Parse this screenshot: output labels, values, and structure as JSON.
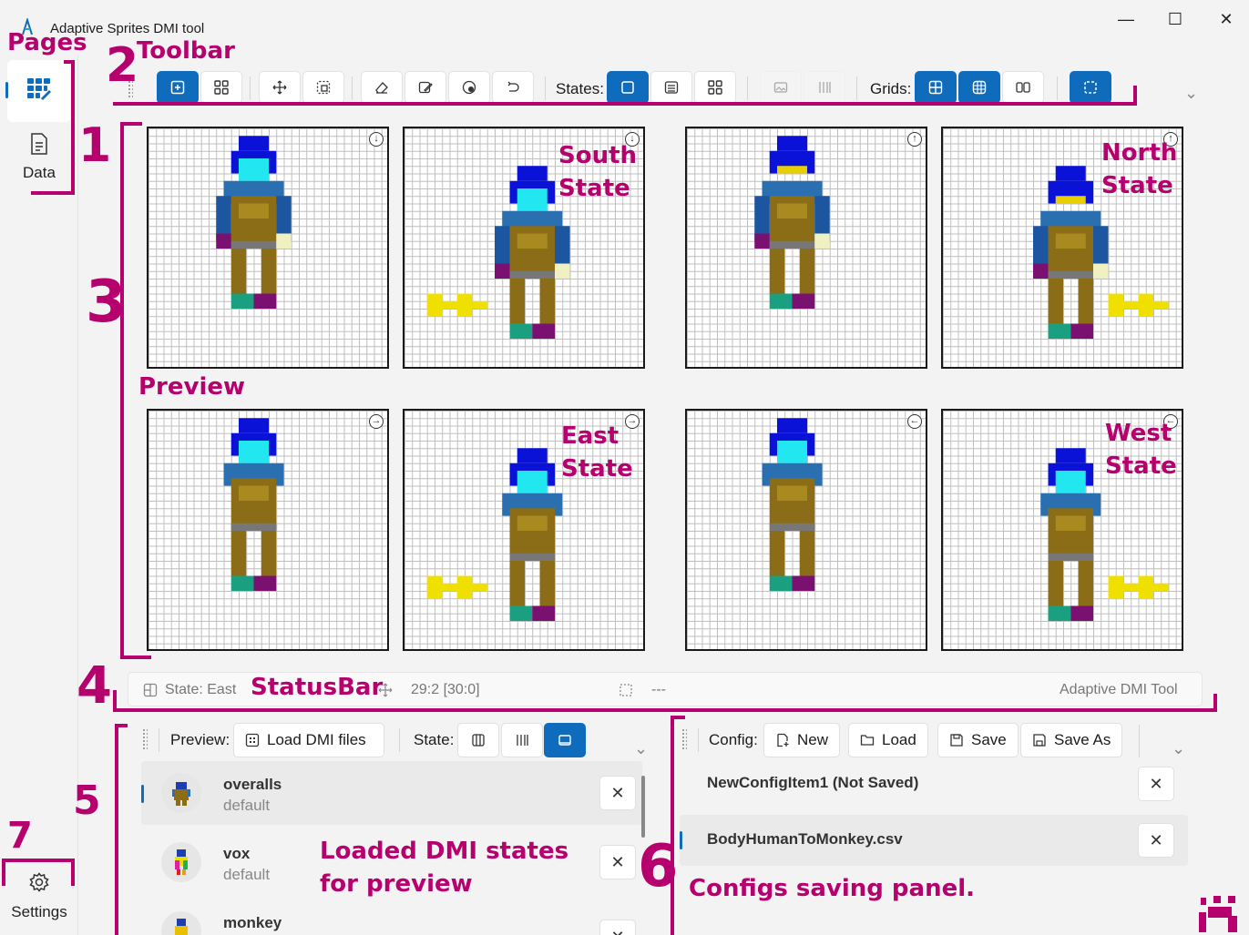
{
  "window": {
    "title": "Adaptive Sprites DMI tool",
    "minimize": "—",
    "maximize": "☐",
    "close": "✕"
  },
  "nav": {
    "items": [
      {
        "label": "",
        "icon": "grid-icon"
      },
      {
        "label": "Data",
        "icon": "document-icon"
      }
    ],
    "settings": {
      "label": "Settings",
      "icon": "gear-icon"
    }
  },
  "toolbar": {
    "states_label": "States:",
    "grids_label": "Grids:",
    "chevron": "⌄"
  },
  "preview": {
    "tiles": [
      {
        "direction": "south",
        "dir_glyph": "↓",
        "variant": "overalls"
      },
      {
        "direction": "south",
        "dir_glyph": "↓",
        "variant": "monkey"
      },
      {
        "direction": "north",
        "dir_glyph": "↑",
        "variant": "overalls"
      },
      {
        "direction": "north",
        "dir_glyph": "↑",
        "variant": "monkey"
      },
      {
        "direction": "east",
        "dir_glyph": "→",
        "variant": "overalls"
      },
      {
        "direction": "east",
        "dir_glyph": "→",
        "variant": "monkey"
      },
      {
        "direction": "west",
        "dir_glyph": "←",
        "variant": "overalls"
      },
      {
        "direction": "west",
        "dir_glyph": "←",
        "variant": "monkey"
      }
    ]
  },
  "statusbar": {
    "state": "State: East",
    "coords": "29:2 [30:0]",
    "selection": "---",
    "app_name": "Adaptive DMI Tool"
  },
  "preview_panel": {
    "preview_label": "Preview:",
    "load_button": "Load DMI files",
    "state_label": "State:",
    "items": [
      {
        "title": "overalls",
        "subtitle": "default",
        "selected": true
      },
      {
        "title": "vox",
        "subtitle": "default",
        "selected": false
      },
      {
        "title": "monkey",
        "subtitle": "",
        "selected": false
      }
    ]
  },
  "config_panel": {
    "config_label": "Config:",
    "new_button": "New",
    "load_button": "Load",
    "save_button": "Save",
    "save_as_button": "Save As",
    "items": [
      {
        "title": "NewConfigItem1 (Not Saved)",
        "selected": false
      },
      {
        "title": "BodyHumanToMonkey.csv",
        "selected": true
      }
    ]
  },
  "annotations": {
    "pages": "Pages",
    "toolbar": "Toolbar",
    "preview": "Preview",
    "statusbar": "StatusBar",
    "south_state": [
      "South",
      "State"
    ],
    "north_state": [
      "North",
      "State"
    ],
    "east_state": [
      "East",
      "State"
    ],
    "west_state": [
      "West",
      "State"
    ],
    "loaded_states": [
      "Loaded DMI states",
      "for preview"
    ],
    "configs_panel": "Configs saving panel.",
    "numbers": [
      "1",
      "2",
      "3",
      "4",
      "5",
      "6",
      "7"
    ]
  },
  "colors": {
    "accent": "#0f6cbd",
    "annotation": "#b5006e"
  }
}
